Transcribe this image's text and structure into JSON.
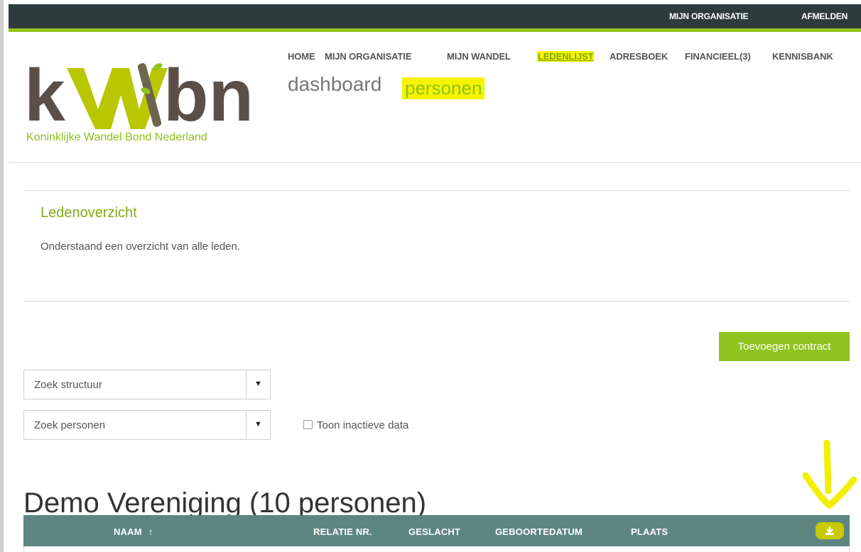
{
  "colors": {
    "topbar_bg": "#2d3c3a",
    "accent_green": "#8fc31f",
    "highlight_yellow": "#f6f300",
    "table_header_bg": "#5e8681"
  },
  "topbar": {
    "links": [
      {
        "label": "MIJN ORGANISATIE"
      },
      {
        "label": "AFMELDEN"
      }
    ]
  },
  "logo": {
    "wordmark": "kWbn",
    "tagline": "Koninklijke Wandel Bond Nederland"
  },
  "main_nav": {
    "items": [
      {
        "label": "HOME",
        "active": false
      },
      {
        "label": "MIJN ORGANISATIE",
        "active": false
      },
      {
        "label": "MIJN WANDEL",
        "active": false
      },
      {
        "label": "LEDENLIJST",
        "active": true
      },
      {
        "label": "ADRESBOEK",
        "active": false
      },
      {
        "label": "FINANCIEEL(3)",
        "active": false
      },
      {
        "label": "KENNISBANK",
        "active": false
      }
    ]
  },
  "sub_nav": {
    "items": [
      {
        "label": "dashboard",
        "active": false
      },
      {
        "label": "personen",
        "active": true
      }
    ]
  },
  "section": {
    "title": "Ledenoverzicht",
    "description": "Onderstaand een overzicht van alle leden."
  },
  "actions": {
    "add_contract_label": "Toevoegen contract"
  },
  "filters": {
    "structure_placeholder": "Zoek structuur",
    "persons_placeholder": "Zoek personen",
    "show_inactive_label": "Toon inactieve data",
    "show_inactive_checked": false
  },
  "list": {
    "heading": "Demo Vereniging (10 personen)",
    "columns": [
      {
        "label": "NAAM",
        "sort": "ascending"
      },
      {
        "label": "RELATIE NR."
      },
      {
        "label": "GESLACHT"
      },
      {
        "label": "GEBOORTEDATUM"
      },
      {
        "label": "PLAATS"
      }
    ],
    "download_icon": "download-icon"
  }
}
